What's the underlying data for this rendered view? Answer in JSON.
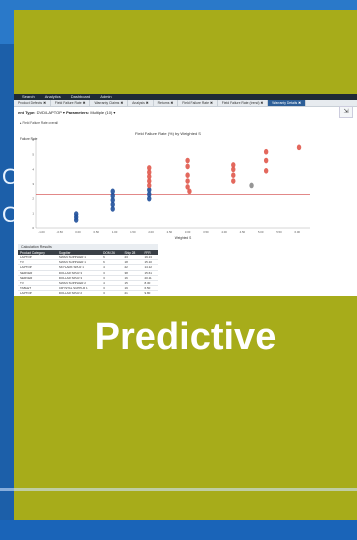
{
  "heading": "Predictive",
  "left_glyphs": [
    "O",
    "O"
  ],
  "colors": {
    "card": "#a7ac1a",
    "background": "#1a64b8",
    "threshold": "#d04040",
    "blue_series": "#1f4f9a",
    "red_series": "#e0584b"
  },
  "screenshot": {
    "menu": [
      "Search",
      "Analytics",
      "Dashboard",
      "Admin"
    ],
    "tabs": [
      {
        "label": "Product Defects ✖",
        "active": false
      },
      {
        "label": "Field Failure Rate ✖",
        "active": false
      },
      {
        "label": "Warranty Claims ✖",
        "active": false
      },
      {
        "label": "Analysis ✖",
        "active": false
      },
      {
        "label": "Returns ✖",
        "active": false
      },
      {
        "label": "Field Failure Rate ✖",
        "active": false
      },
      {
        "label": "Field Failure Rate (trend) ✖",
        "active": false
      },
      {
        "label": "Warranty Details ✖",
        "active": true
      }
    ],
    "filters": {
      "type_label": "ent Type:",
      "type_value": "DVD/LAPTOP ▾",
      "param_label": "Parameters:",
      "param_value": "Multiple (10) ▾"
    },
    "toggle_label": "▸ Field Failure Rate overall",
    "corner_button": "⇲",
    "table": {
      "title": "Calculation Results",
      "columns": [
        "Product Category",
        "Supplier",
        "DOM 26",
        "Ship 28",
        "FFR"
      ],
      "rows": [
        [
          "LAPTOP",
          "SWAN SUPPLIER 1",
          "6",
          "23",
          "19.13"
        ],
        [
          "TV",
          "SWAN SUPPLIER 1",
          "6",
          "18",
          "15.10"
        ],
        [
          "LAPTOP",
          "SKYLARK SPLR 1",
          "4",
          "22",
          "14.12"
        ],
        [
          "SERVER",
          "DOLLAR SPLR 3",
          "3",
          "38",
          "15.61"
        ],
        [
          "SERVER",
          "DOLLAR SPLR 3",
          "3",
          "16",
          "20.11"
        ],
        [
          "TV",
          "SWAN SUPPLIER 2",
          "4",
          "15",
          "8.30"
        ],
        [
          "TABLET",
          "CRYSTAL SUPPLR 1",
          "3",
          "19",
          "6.50"
        ],
        [
          "LAPTOP",
          "DOLLAR SPLR 2",
          "3",
          "21",
          "9.80"
        ]
      ]
    }
  },
  "chart_data": {
    "type": "scatter",
    "title": "Field Failure Rate (%) by Weighted S",
    "xlabel": "Weighted S",
    "ylabel": "Failure Rate",
    "xlim": [
      -1,
      6.5
    ],
    "ylim": [
      0,
      6
    ],
    "threshold_y": 2.3,
    "x_ticks": [
      "-1.00",
      "-0.50",
      "0.00",
      "0.50",
      "1.00",
      "1.50",
      "2.00",
      "2.50",
      "3.00",
      "3.50",
      "4.00",
      "4.50",
      "5.00",
      "5.50",
      "6.00"
    ],
    "y_ticks": [
      "0",
      "1",
      "2",
      "3",
      "4",
      "5",
      "6"
    ],
    "series": [
      {
        "color": "#1f4f9a",
        "points": [
          [
            0.1,
            0.55
          ],
          [
            0.1,
            0.75
          ],
          [
            0.1,
            0.95
          ],
          [
            1.1,
            1.3
          ],
          [
            1.1,
            1.6
          ],
          [
            1.1,
            1.9
          ],
          [
            1.1,
            2.2
          ],
          [
            1.1,
            2.5
          ],
          [
            2.1,
            2.0
          ],
          [
            2.1,
            2.3
          ],
          [
            2.1,
            2.6
          ]
        ]
      },
      {
        "color": "#e0584b",
        "points": [
          [
            2.1,
            2.9
          ],
          [
            2.1,
            3.2
          ],
          [
            2.1,
            3.5
          ],
          [
            2.1,
            3.8
          ],
          [
            2.1,
            4.1
          ],
          [
            3.15,
            2.8
          ],
          [
            3.15,
            3.2
          ],
          [
            3.15,
            3.6
          ],
          [
            3.15,
            4.2
          ],
          [
            3.15,
            4.6
          ],
          [
            3.2,
            2.5
          ],
          [
            4.4,
            3.2
          ],
          [
            4.4,
            3.6
          ],
          [
            4.4,
            4.0
          ],
          [
            4.4,
            4.3
          ],
          [
            5.3,
            3.9
          ],
          [
            5.3,
            4.6
          ],
          [
            5.3,
            5.2
          ],
          [
            6.2,
            5.5
          ]
        ]
      },
      {
        "color": "#8a8a8a",
        "points": [
          [
            4.9,
            2.9
          ]
        ]
      }
    ]
  }
}
